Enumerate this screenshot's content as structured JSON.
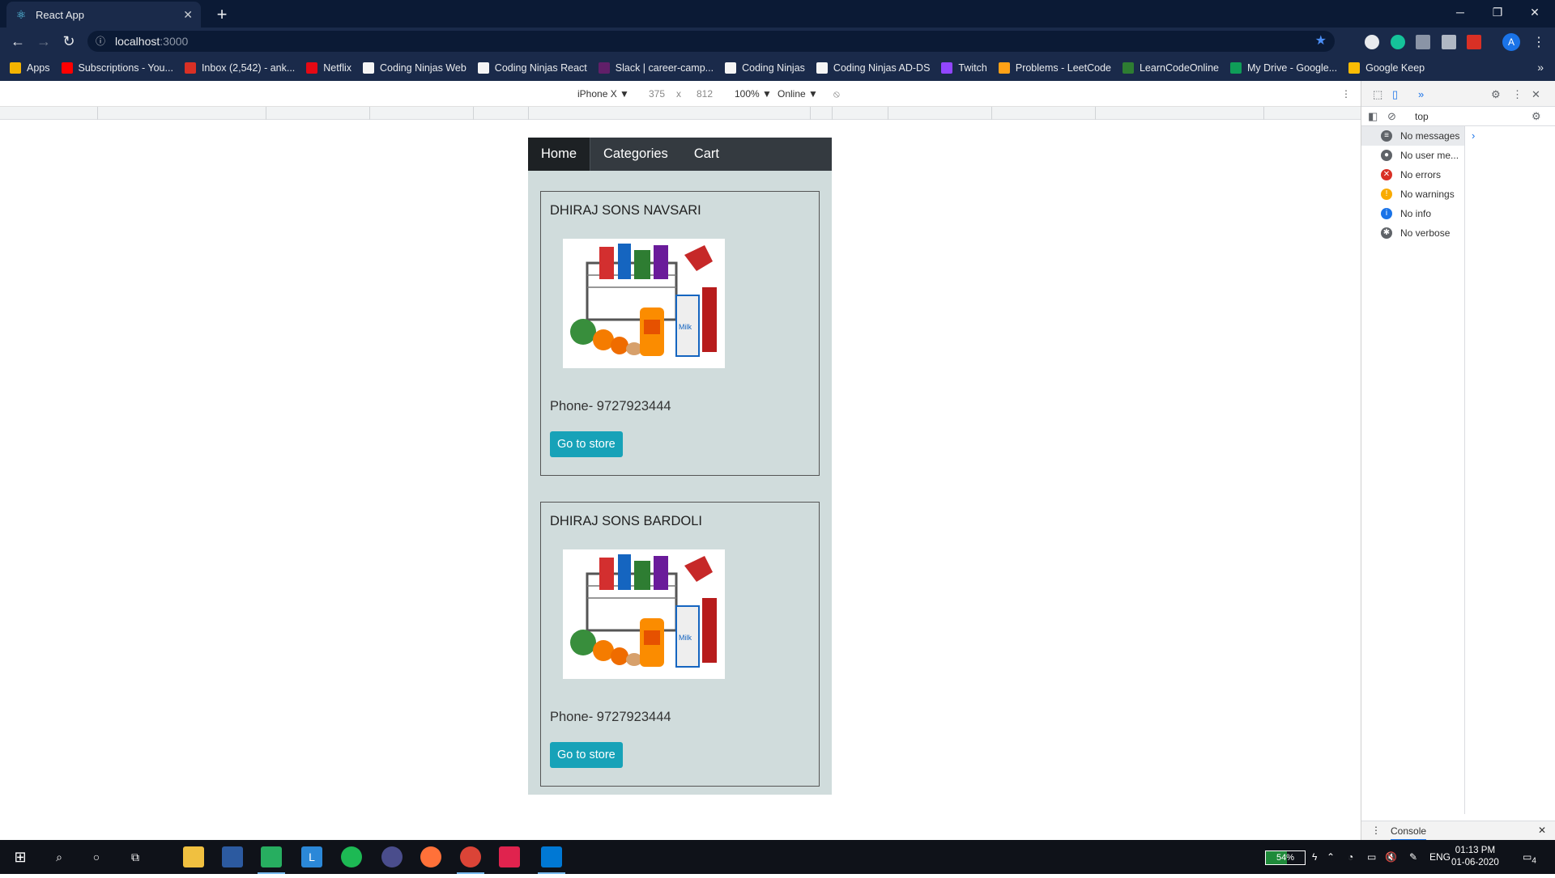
{
  "browser": {
    "tab_title": "React App",
    "tab_favicon": "react-icon",
    "url_host": "localhost",
    "url_port": ":3000",
    "profile_initial": "A"
  },
  "bookmarks": [
    {
      "label": "Apps",
      "icon": "apps-grid-icon",
      "color": "#f4b400"
    },
    {
      "label": "Subscriptions - You...",
      "icon": "youtube-icon",
      "color": "#ff0000"
    },
    {
      "label": "Inbox (2,542) - ank...",
      "icon": "gmail-icon",
      "color": "#d93025"
    },
    {
      "label": "Netflix",
      "icon": "netflix-icon",
      "color": "#e50914"
    },
    {
      "label": "Coding Ninjas Web",
      "icon": "coding-ninjas-icon",
      "color": "#f5f5f5"
    },
    {
      "label": "Coding Ninjas React",
      "icon": "coding-ninjas-icon",
      "color": "#f5f5f5"
    },
    {
      "label": "Slack | career-camp...",
      "icon": "slack-icon",
      "color": "#611f69"
    },
    {
      "label": "Coding Ninjas",
      "icon": "coding-ninjas-icon",
      "color": "#f5f5f5"
    },
    {
      "label": "Coding Ninjas AD-DS",
      "icon": "coding-ninjas-icon",
      "color": "#f5f5f5"
    },
    {
      "label": "Twitch",
      "icon": "twitch-icon",
      "color": "#9146ff"
    },
    {
      "label": "Problems - LeetCode",
      "icon": "leetcode-icon",
      "color": "#ffa116"
    },
    {
      "label": "LearnCodeOnline",
      "icon": "lco-icon",
      "color": "#2e7d32"
    },
    {
      "label": "My Drive - Google...",
      "icon": "google-drive-icon",
      "color": "#0f9d58"
    },
    {
      "label": "Google Keep",
      "icon": "google-keep-icon",
      "color": "#fbbc04"
    }
  ],
  "device_toolbar": {
    "device": "iPhone X ▼",
    "width": "375",
    "times": "x",
    "height": "812",
    "zoom": "100% ▼",
    "network": "Online ▼"
  },
  "app": {
    "nav": [
      "Home",
      "Categories",
      "Cart"
    ],
    "stores": [
      {
        "name": "DHIRAJ SONS NAVSARI",
        "phone": "Phone- 9727923444",
        "button": "Go to store"
      },
      {
        "name": "DHIRAJ SONS BARDOLI",
        "phone": "Phone- 9727923444",
        "button": "Go to store"
      }
    ],
    "colors": {
      "navbar": "#343a40",
      "page_bg": "#d0dcdc",
      "button": "#17a2b8"
    }
  },
  "devtools": {
    "filter_value": "top",
    "messages": [
      {
        "label": "No messages",
        "icon": "list-icon",
        "color": "#5f6368"
      },
      {
        "label": "No user me...",
        "icon": "user-icon",
        "color": "#5f6368"
      },
      {
        "label": "No errors",
        "icon": "error-icon",
        "color": "#d93025"
      },
      {
        "label": "No warnings",
        "icon": "warning-icon",
        "color": "#f9ab00"
      },
      {
        "label": "No info",
        "icon": "info-icon",
        "color": "#1a73e8"
      },
      {
        "label": "No verbose",
        "icon": "bug-icon",
        "color": "#5f6368"
      }
    ],
    "drawer_tab": "Console"
  },
  "taskbar": {
    "battery": "54%",
    "battery_level": 0.54,
    "language": "ENG",
    "time": "01:13 PM",
    "date": "01-06-2020",
    "notifications": "4"
  }
}
